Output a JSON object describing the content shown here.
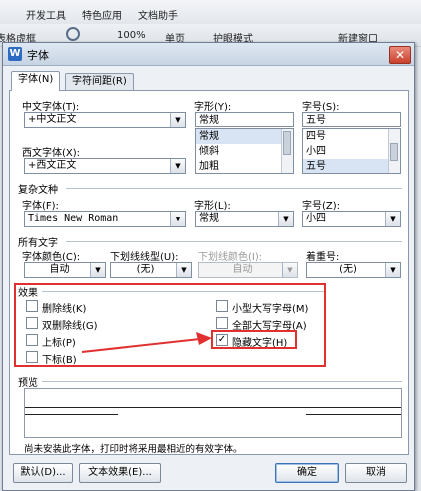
{
  "app": {
    "menu": [
      "开发工具",
      "特色应用",
      "文档助手"
    ],
    "toolbar": {
      "left_text": "表格虚框",
      "zoom": "100%",
      "single_page": "单页",
      "eye_mode": "护眼模式",
      "new_window": "新建窗口"
    }
  },
  "dialog": {
    "title": "字体",
    "icon_letter": "W",
    "close_glyph": "✕",
    "tabs": [
      "字体(N)",
      "字符间距(R)"
    ],
    "chinese_font": {
      "label": "中文字体(T):",
      "value": "+中文正文"
    },
    "western_font": {
      "label": "西文字体(X):",
      "value": "+西文正文"
    },
    "style": {
      "label": "字形(Y):",
      "value": "常规",
      "options": [
        "常规",
        "倾斜",
        "加粗"
      ],
      "selected": 0
    },
    "size": {
      "label": "字号(S):",
      "value": "五号",
      "options": [
        "四号",
        "小四",
        "五号"
      ],
      "selected": 2
    },
    "complex": {
      "section": "复杂文种",
      "font_label": "字体(F):",
      "font_value": "Times New Roman",
      "style_label": "字形(L):",
      "style_value": "常规",
      "size_label": "字号(Z):",
      "size_value": "小四"
    },
    "all_text": {
      "section": "所有文字",
      "color_label": "字体颜色(C):",
      "color_value": "自动",
      "underline_label": "下划线线型(U):",
      "underline_value": "(无)",
      "underline_color_label": "下划线颜色(I):",
      "underline_color_value": "自动",
      "emphasis_label": "着重号:",
      "emphasis_value": "(无)"
    },
    "effects": {
      "section": "效果",
      "items": [
        {
          "label": "删除线(K)",
          "checked": false
        },
        {
          "label": "双删除线(G)",
          "checked": false
        },
        {
          "label": "上标(P)",
          "checked": false
        },
        {
          "label": "下标(B)",
          "checked": false
        },
        {
          "label": "小型大写字母(M)",
          "checked": false
        },
        {
          "label": "全部大写字母(A)",
          "checked": false
        },
        {
          "label": "隐藏文字(H)",
          "checked": true
        }
      ],
      "check_glyph": "✓",
      "highlight_color": "#e03030"
    },
    "preview": {
      "section": "预览"
    },
    "note": "尚未安装此字体，打印时将采用最相近的有效字体。",
    "buttons": {
      "default": "默认(D)...",
      "text_effects": "文本效果(E)...",
      "ok": "确定",
      "cancel": "取消"
    }
  }
}
